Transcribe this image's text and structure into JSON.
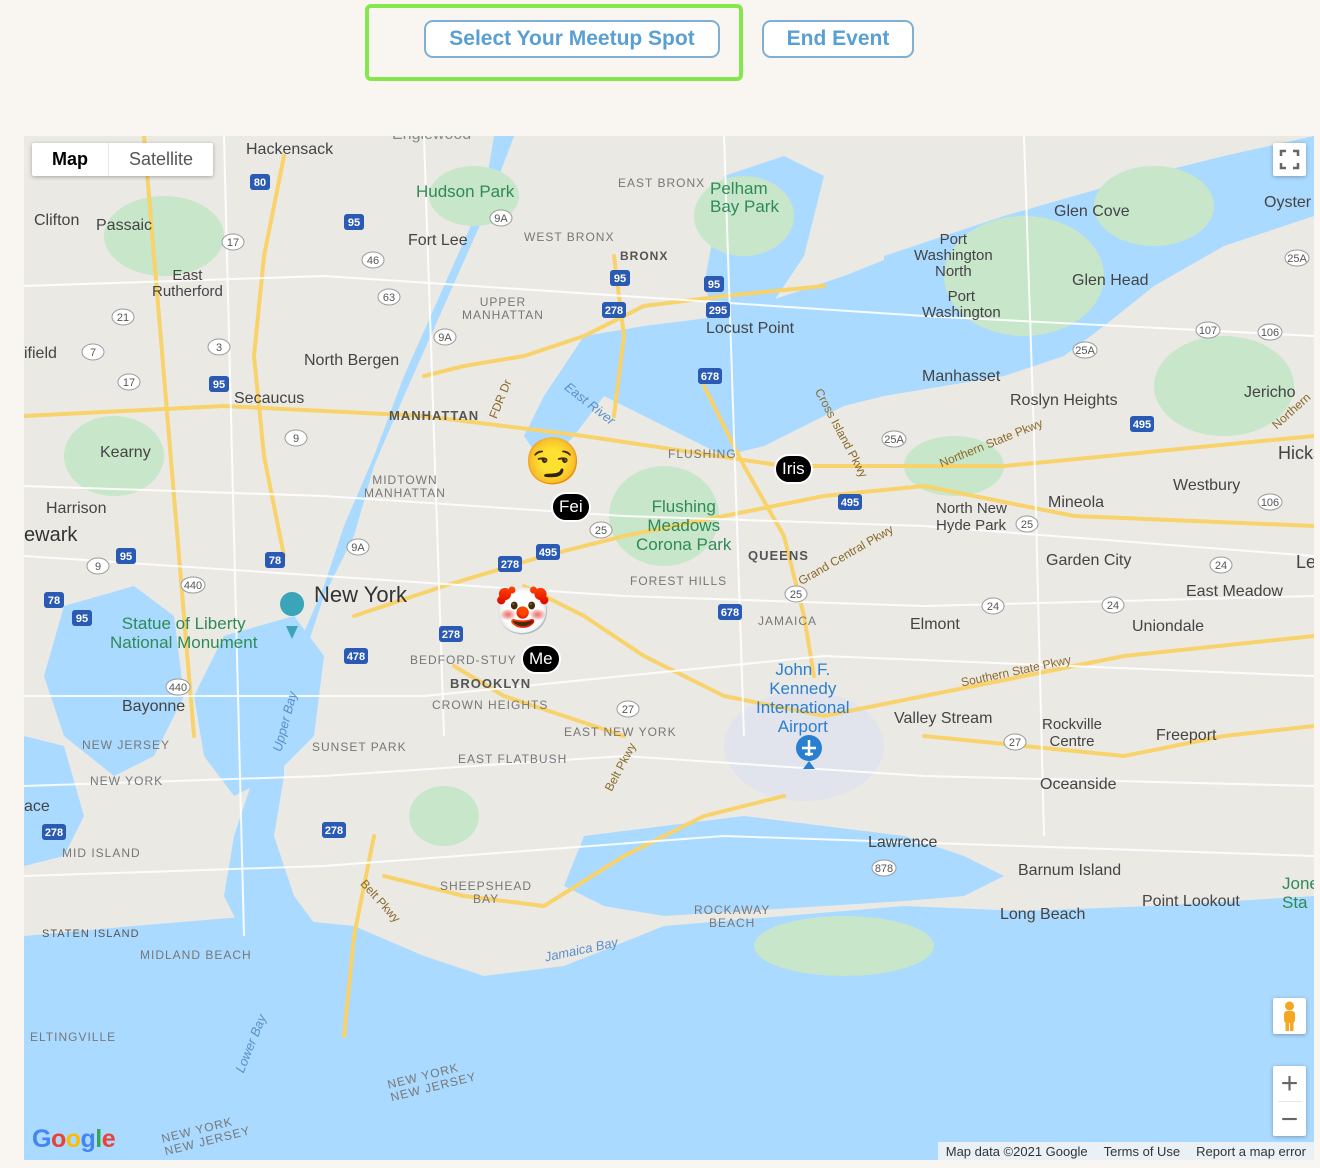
{
  "toolbar": {
    "select_spot_label": "Select Your Meetup Spot",
    "end_event_label": "End Event",
    "highlight_color": "#84e84c",
    "button_color": "#5a9fd1"
  },
  "map": {
    "type_control": {
      "map_label": "Map",
      "satellite_label": "Satellite",
      "selected": "Map"
    },
    "markers": [
      {
        "label": "Iris"
      },
      {
        "label": "Fei"
      },
      {
        "label": "Me"
      }
    ],
    "emoji_markers": [
      {
        "name": "smirking-face",
        "glyph": "😏"
      },
      {
        "name": "clown-face",
        "glyph": "🤡"
      }
    ],
    "zoom": {
      "in_label": "+",
      "out_label": "−"
    },
    "attribution": {
      "map_data": "Map data ©2021 Google",
      "terms": "Terms of Use",
      "report": "Report a map error"
    },
    "logo": "Google",
    "places": {
      "hackensack": "Hackensack",
      "clifton": "Clifton",
      "passaic": "Passaic",
      "hudson_park": "Hudson Park",
      "fort_lee": "Fort Lee",
      "east_rutherford": "East\nRutherford",
      "north_bergen": "North Bergen",
      "secaucus": "Secaucus",
      "kearny": "Kearny",
      "harrison": "Harrison",
      "newark": "ewark",
      "ifield": "ifield",
      "manhattan": "MANHATTAN",
      "upper_manhattan": "UPPER\nMANHATTAN",
      "midtown": "MIDTOWN\nMANHATTAN",
      "new_york": "New York",
      "statue": "Statue of Liberty\nNational Monument",
      "bayonne": "Bayonne",
      "new_jersey": "NEW JERSEY",
      "new_york_state": "NEW YORK",
      "ace": "ace",
      "mid_island": "MID ISLAND",
      "staten_island": "STATEN ISLAND",
      "midland_beach": "MIDLAND BEACH",
      "eltingville": "ELTINGVILLE",
      "east_bronx": "EAST BRONX",
      "west_bronx": "WEST BRONX",
      "bronx": "BRONX",
      "pelham": "Pelham\nBay Park",
      "locust_point": "Locust Point",
      "flushing": "FLUSHING",
      "flushing_meadows": "Flushing\nMeadows\nCorona Park",
      "queens": "QUEENS",
      "forest_hills": "FOREST HILLS",
      "jamaica": "JAMAICA",
      "bedford": "BEDFORD-STUY",
      "brooklyn": "BROOKLYN",
      "crown_heights": "CROWN HEIGHTS",
      "east_new_york": "EAST NEW YORK",
      "east_flatbush": "EAST FLATBUSH",
      "sunset_park": "SUNSET PARK",
      "sheepshead": "SHEEPSHEAD\nBAY",
      "rockaway": "ROCKAWAY\nBEACH",
      "jfk": "John F.\nKennedy\nInternational\nAirport",
      "glen_cove": "Glen Cove",
      "oyster_bay": "Oyster Ba",
      "port_wash_north": "Port\nWashington\nNorth",
      "port_washington": "Port\nWashington",
      "glen_head": "Glen Head",
      "manhasset": "Manhasset",
      "roslyn": "Roslyn Heights",
      "jericho": "Jericho",
      "hicksv": "Hicksv",
      "westbury": "Westbury",
      "mineola": "Mineola",
      "north_new_hyde": "North New\nHyde Park",
      "garden_city": "Garden City",
      "levi": "Levi",
      "east_meadow": "East Meadow",
      "uniondale": "Uniondale",
      "elmont": "Elmont",
      "valley_stream": "Valley Stream",
      "rockville": "Rockville\nCentre",
      "freeport": "Freeport",
      "oceanside": "Oceanside",
      "lawrence": "Lawrence",
      "barnum": "Barnum Island",
      "point_lookout": "Point Lookout",
      "long_beach": "Long Beach",
      "jones": "Jone\nSta",
      "englewood": "Englewood",
      "east_river": "East River",
      "upper_bay": "Upper Bay",
      "lower_bay": "Lower Bay",
      "jamaica_bay": "Jamaica Bay",
      "ny_nj_1": "NEW YORK\nNEW JERSEY",
      "ny_nj_2": "NEW YORK\nNEW JERSEY",
      "fdr": "FDR Dr",
      "cross_island": "Cross Island Pkwy",
      "northern_state": "Northern State Pkwy",
      "grand_central": "Grand Central Pkwy",
      "southern_state": "Southern State Pkwy",
      "belt_pkwy_1": "Belt Pkwy",
      "belt_pkwy_2": "Belt Pkwy",
      "northern": "Northern"
    }
  }
}
